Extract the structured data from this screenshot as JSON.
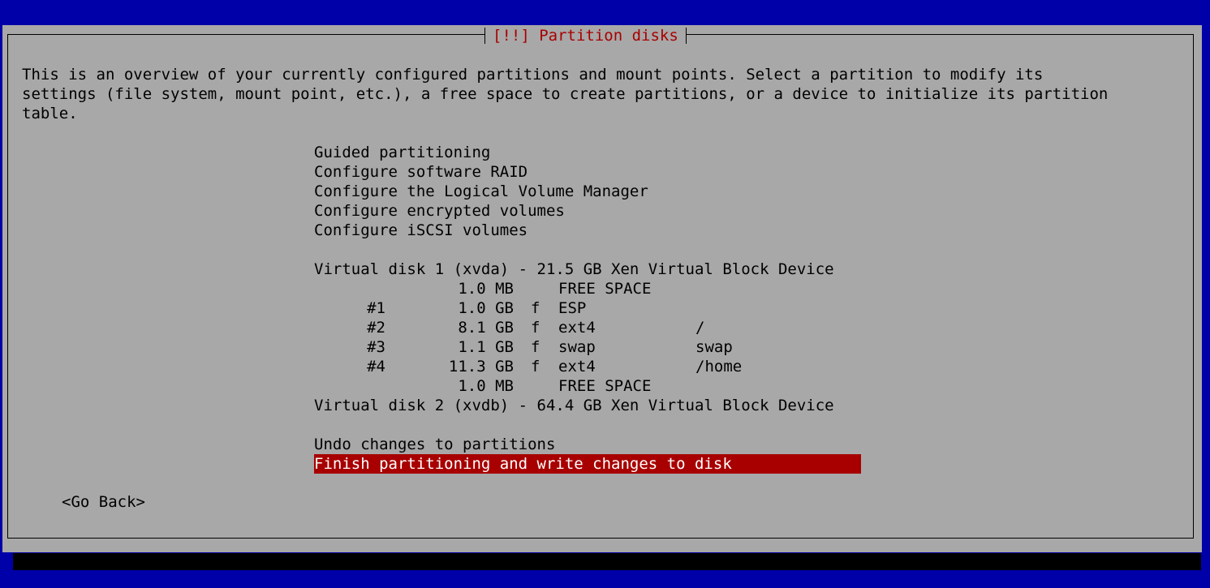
{
  "dialog": {
    "title": "[!!] Partition disks",
    "description": [
      "This is an overview of your currently configured partitions and mount points. Select a partition to modify its",
      "settings (file system, mount point, etc.), a free space to create partitions, or a device to initialize its partition",
      "table."
    ]
  },
  "menu": {
    "options": [
      "Guided partitioning",
      "Configure software RAID",
      "Configure the Logical Volume Manager",
      "Configure encrypted volumes",
      "Configure iSCSI volumes"
    ],
    "disk1": {
      "label": "Virtual disk 1 (xvda) - 21.5 GB Xen Virtual Block Device",
      "rows": [
        {
          "num": "",
          "size": "1.0 MB",
          "flag": "",
          "fs": "FREE SPACE",
          "mount": ""
        },
        {
          "num": "#1",
          "size": "1.0 GB",
          "flag": "f",
          "fs": "ESP",
          "mount": ""
        },
        {
          "num": "#2",
          "size": "8.1 GB",
          "flag": "f",
          "fs": "ext4",
          "mount": "/"
        },
        {
          "num": "#3",
          "size": "1.1 GB",
          "flag": "f",
          "fs": "swap",
          "mount": "swap"
        },
        {
          "num": "#4",
          "size": "11.3 GB",
          "flag": "f",
          "fs": "ext4",
          "mount": "/home"
        },
        {
          "num": "",
          "size": "1.0 MB",
          "flag": "",
          "fs": "FREE SPACE",
          "mount": ""
        }
      ]
    },
    "disk2": {
      "label": "Virtual disk 2 (xvdb) - 64.4 GB Xen Virtual Block Device"
    },
    "undo": "Undo changes to partitions",
    "finish": "Finish partitioning and write changes to disk"
  },
  "buttons": {
    "go_back": "<Go Back>"
  },
  "colors": {
    "background": "#0000a8",
    "dialog": "#a8a8a8",
    "title": "#a80000",
    "selection": "#a80000",
    "selection_text": "#ffffff"
  }
}
